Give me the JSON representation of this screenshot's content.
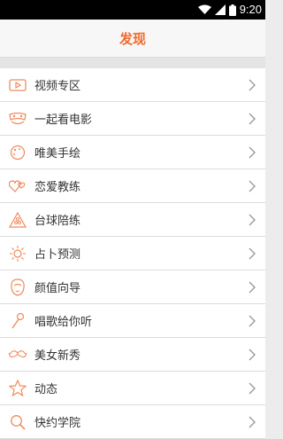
{
  "status_bar": {
    "time": "9:20"
  },
  "header": {
    "title": "发现"
  },
  "colors": {
    "accent": "#f06a2b",
    "icon": "#f08a5d",
    "chevron": "#9a9a9a"
  },
  "menu": [
    {
      "label": "视频专区",
      "icon": "video-icon"
    },
    {
      "label": "一起看电影",
      "icon": "movie-mask-icon"
    },
    {
      "label": "唯美手绘",
      "icon": "palette-icon"
    },
    {
      "label": "恋爱教练",
      "icon": "hearts-icon"
    },
    {
      "label": "台球陪练",
      "icon": "billiards-icon"
    },
    {
      "label": "占卜预测",
      "icon": "sun-icon"
    },
    {
      "label": "颜值向导",
      "icon": "face-icon"
    },
    {
      "label": "唱歌给你听",
      "icon": "microphone-icon"
    },
    {
      "label": "美女新秀",
      "icon": "mustache-icon"
    },
    {
      "label": "动态",
      "icon": "star-icon"
    },
    {
      "label": "快约学院",
      "icon": "search-icon"
    }
  ]
}
